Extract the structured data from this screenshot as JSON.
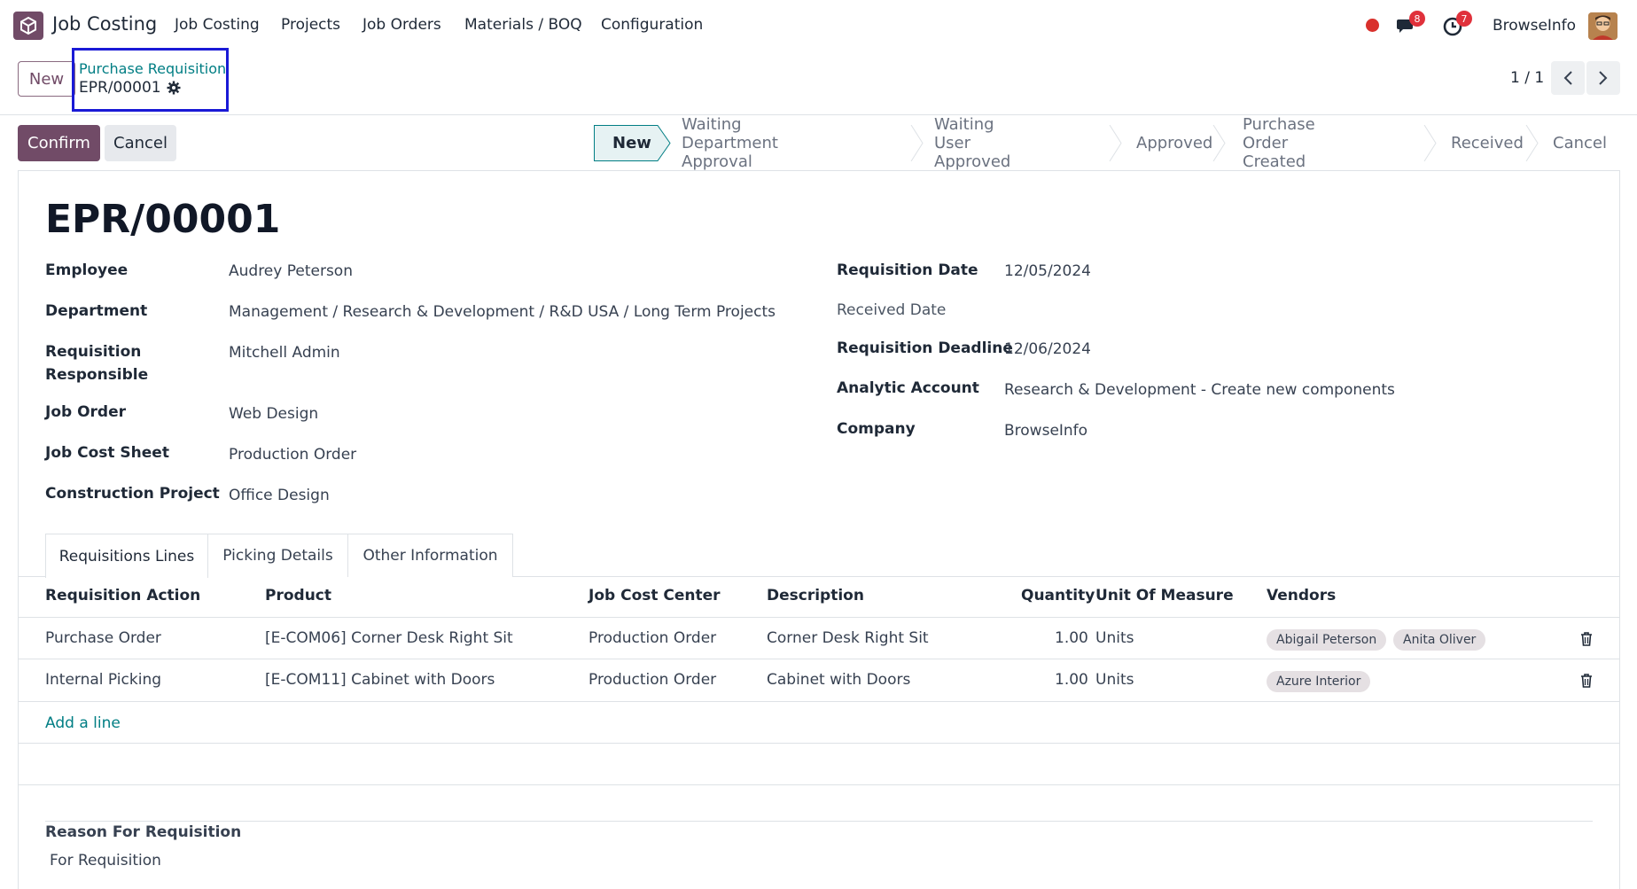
{
  "navbar": {
    "app_name": "Job Costing",
    "menus": [
      "Job Costing",
      "Projects",
      "Job Orders",
      "Materials / BOQ",
      "Configuration"
    ],
    "messages_count": "8",
    "activities_count": "7",
    "company": "BrowseInfo"
  },
  "control_panel": {
    "new_label": "New",
    "breadcrumb_parent": "Purchase Requisition",
    "breadcrumb_current": "EPR/00001",
    "pager": "1 / 1"
  },
  "actions": {
    "confirm_label": "Confirm",
    "cancel_label": "Cancel"
  },
  "statusbar": {
    "stages": [
      "New",
      "Waiting Department Approval",
      "Waiting User Approved",
      "Approved",
      "Purchase Order Created",
      "Received",
      "Cancel"
    ],
    "active": "New"
  },
  "record": {
    "title": "EPR/00001",
    "left_fields": [
      {
        "label": "Employee",
        "value": "Audrey Peterson"
      },
      {
        "label": "Department",
        "value": "Management / Research & Development / R&D USA / Long Term Projects"
      },
      {
        "label": "Requisition Responsible",
        "value": "Mitchell Admin"
      },
      {
        "label": "Job Order",
        "value": "Web Design"
      },
      {
        "label": "Job Cost Sheet",
        "value": "Production Order"
      },
      {
        "label": "Construction Project",
        "value": "Office Design"
      }
    ],
    "right_fields": [
      {
        "label": "Requisition Date",
        "value": "12/05/2024"
      },
      {
        "label": "Received Date",
        "value": ""
      },
      {
        "label": "Requisition Deadline",
        "value": "12/06/2024"
      },
      {
        "label": "Analytic Account",
        "value": "Research & Development - Create new components"
      },
      {
        "label": "Company",
        "value": "BrowseInfo"
      }
    ]
  },
  "tabs": [
    "Requisitions Lines",
    "Picking Details",
    "Other Information"
  ],
  "table": {
    "columns": [
      "Requisition Action",
      "Product",
      "Job Cost Center",
      "Description",
      "Quantity",
      "Unit Of Measure",
      "Vendors"
    ],
    "rows": [
      {
        "action": "Purchase Order",
        "product": "[E-COM06] Corner Desk Right Sit",
        "center": "Production Order",
        "description": "Corner Desk Right Sit",
        "quantity": "1.00",
        "uom": "Units",
        "vendors": [
          "Abigail Peterson",
          "Anita Oliver"
        ]
      },
      {
        "action": "Internal Picking",
        "product": "[E-COM11] Cabinet with Doors",
        "center": "Production Order",
        "description": "Cabinet with Doors",
        "quantity": "1.00",
        "uom": "Units",
        "vendors": [
          "Azure Interior"
        ]
      }
    ],
    "add_line": "Add a line"
  },
  "reason": {
    "label": "Reason For Requisition",
    "value": "For Requisition"
  }
}
